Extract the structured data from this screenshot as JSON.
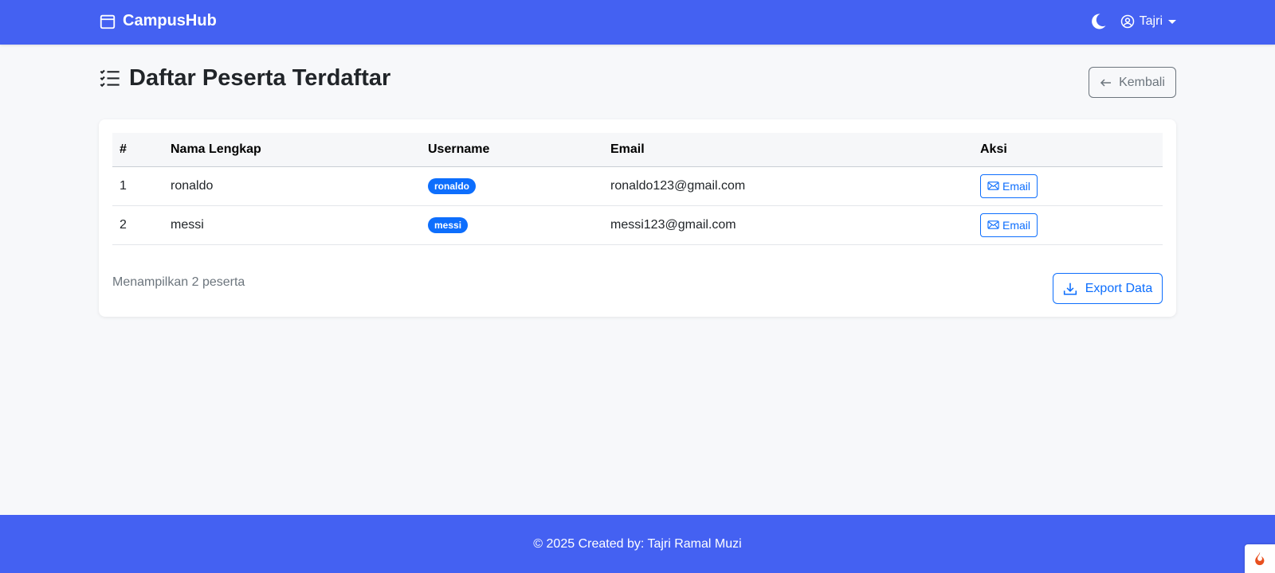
{
  "navbar": {
    "brand": "CampusHub",
    "user_name": "Tajri",
    "brand_icon": "calendar-icon",
    "theme_icon": "moon-icon",
    "user_icon": "user-circle-icon"
  },
  "page": {
    "title": "Daftar Peserta Terdaftar",
    "title_icon": "list-check-icon",
    "back_label": "Kembali"
  },
  "table": {
    "headers": [
      "#",
      "Nama Lengkap",
      "Username",
      "Email",
      "Aksi"
    ],
    "rows": [
      {
        "no": "1",
        "name": "ronaldo",
        "username": "ronaldo",
        "email": "ronaldo123@gmail.com",
        "action": "Email"
      },
      {
        "no": "2",
        "name": "messi",
        "username": "messi",
        "email": "messi123@gmail.com",
        "action": "Email"
      }
    ]
  },
  "summary": {
    "count_text": "Menampilkan 2 peserta",
    "export_label": "Export Data"
  },
  "footer": {
    "text": "© 2025 Created by: Tajri Ramal Muzi"
  },
  "colors": {
    "navbar_bg": "#4461f2",
    "primary": "#0d6efd",
    "secondary": "#6c757d",
    "page_bg": "#f7f8fa"
  }
}
